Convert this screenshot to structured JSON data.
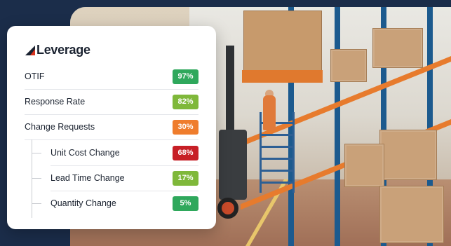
{
  "brand": {
    "name": "Leverage"
  },
  "metrics": [
    {
      "label": "OTIF",
      "value": "97%",
      "color": "#2fa85c"
    },
    {
      "label": "Response Rate",
      "value": "82%",
      "color": "#7fb83a"
    },
    {
      "label": "Change Requests",
      "value": "30%",
      "color": "#ef7d2d"
    }
  ],
  "sub_metrics": [
    {
      "label": "Unit Cost Change",
      "value": "68%",
      "color": "#c71f26"
    },
    {
      "label": "Lead Time Change",
      "value": "17%",
      "color": "#7fb83a"
    },
    {
      "label": "Quantity Change",
      "value": "5%",
      "color": "#2fa85c"
    }
  ],
  "icons": {
    "logo": "leverage-logo-icon"
  }
}
